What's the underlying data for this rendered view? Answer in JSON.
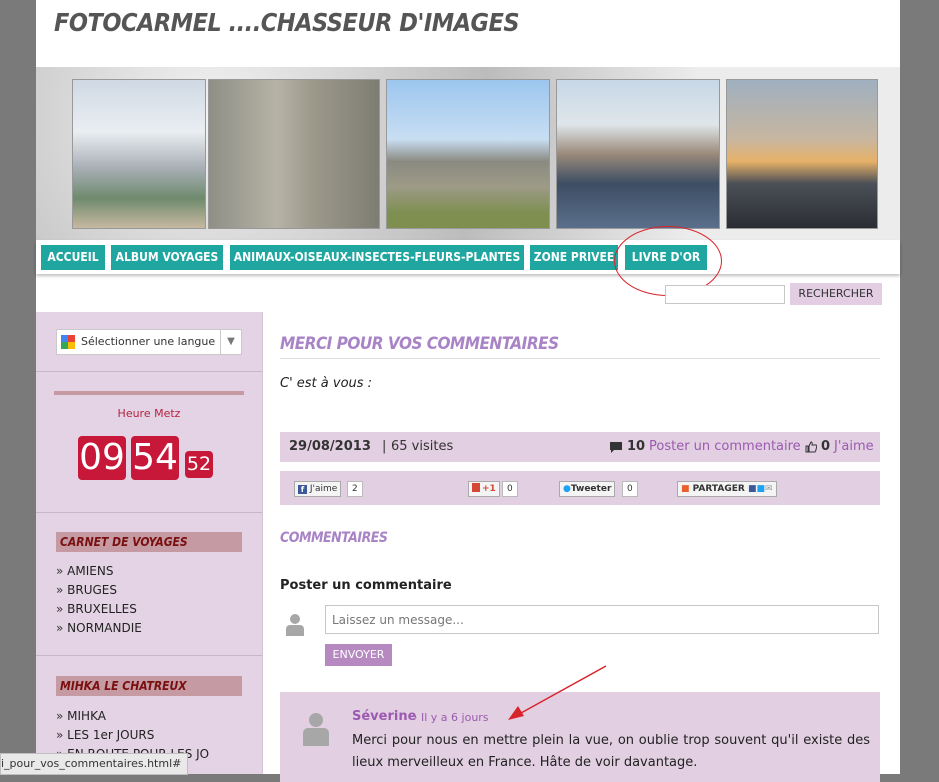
{
  "site": {
    "title": "FOTOCARMEL ....CHASSEUR D'IMAGES"
  },
  "nav": {
    "items": [
      "ACCUEIL",
      "ALBUM VOYAGES",
      "ANIMAUX-OISEAUX-INSECTES-FLEURS-PLANTES",
      "ZONE PRIVEE",
      "LIVRE D'OR"
    ]
  },
  "search": {
    "button": "RECHERCHER"
  },
  "sidebar": {
    "language": "Sélectionner une langue",
    "language_arrow": "▼",
    "clock": {
      "label": "Heure Metz",
      "hours": "09",
      "minutes": "54",
      "seconds": "52"
    },
    "carnet": {
      "title": "CARNET DE VOYAGES",
      "items": [
        "AMIENS",
        "BRUGES",
        "BRUXELLES",
        "NORMANDIE"
      ]
    },
    "mihka": {
      "title": "MIHKA LE CHATREUX",
      "items": [
        "MIHKA",
        "LES 1er JOURS",
        "EN ROUTE POUR LES JO"
      ]
    }
  },
  "post": {
    "title": "MERCI POUR VOS COMMENTAIRES",
    "body": "C' est à vous :",
    "date": "29/08/2013",
    "views": "65 visites",
    "comment_count": "10",
    "comment_link": "Poster un commentaire",
    "like_count": "0",
    "like_link": "J'aime"
  },
  "share": {
    "fb_label": "J'aime",
    "fb_count": "2",
    "gplus_label": "+1",
    "gplus_count": "0",
    "tweet_label": "Tweeter",
    "tweet_count": "0",
    "partager_label": "PARTAGER"
  },
  "comments": {
    "title": "COMMENTAIRES",
    "form_title": "Poster un commentaire",
    "placeholder": "Laissez un message...",
    "send": "ENVOYER",
    "entries": [
      {
        "author": "Séverine",
        "time": "· Il y a 6 jours",
        "text": "Merci pour nous en mettre plein la vue, on oublie trop souvent qu'il existe des lieux merveilleux en France. Hâte de voir davantage."
      }
    ]
  },
  "status_bar": {
    "url": "i_pour_vos_commentaires.html#"
  },
  "colors": {
    "nav": "#20a6a0",
    "sidebar": "#e4d3e4",
    "accent": "#a883c5",
    "clock": "#c8183a",
    "annotation": "#d8232a"
  }
}
